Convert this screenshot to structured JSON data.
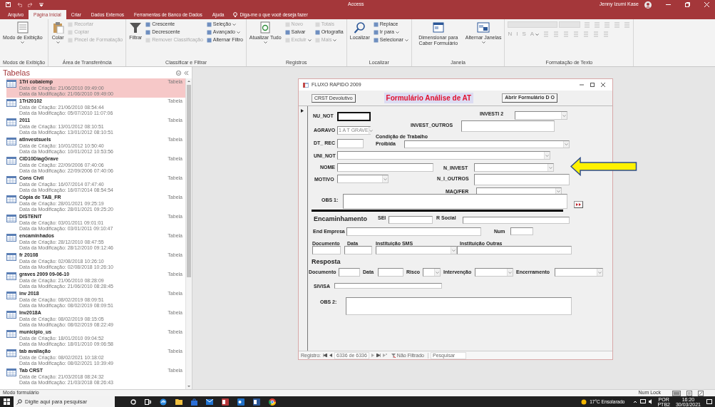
{
  "window": {
    "title": "Access",
    "user": "Jenny Izumi Kase"
  },
  "ribbon_tabs": [
    {
      "label": "Arquivo",
      "selected": false
    },
    {
      "label": "Página Inicial",
      "selected": true
    },
    {
      "label": "Criar",
      "selected": false
    },
    {
      "label": "Dados Externos",
      "selected": false
    },
    {
      "label": "Ferramentas de Banco de Dados",
      "selected": false
    },
    {
      "label": "Ajuda",
      "selected": false
    }
  ],
  "tell_me": {
    "placeholder": "Diga-me o que você deseja fazer"
  },
  "ribbon_groups": [
    {
      "label": "Modos de Exibição",
      "items": [
        {
          "kind": "large",
          "label": "Modo de Exibição",
          "dropdown": true,
          "disabled": false
        }
      ]
    },
    {
      "label": "Área de Transferência",
      "items": [
        {
          "kind": "large",
          "label": "Colar",
          "dropdown": true,
          "disabled": false
        },
        {
          "kind": "small",
          "label": "Recortar",
          "dropdown": false,
          "disabled": true
        },
        {
          "kind": "small",
          "label": "Copiar",
          "dropdown": false,
          "disabled": true
        },
        {
          "kind": "small",
          "label": "Pincel de Formatação",
          "dropdown": false,
          "disabled": true
        }
      ]
    },
    {
      "label": "Classificar e Filtrar",
      "items": [
        {
          "kind": "large",
          "label": "Filtrar",
          "dropdown": false,
          "disabled": false
        },
        {
          "kind": "small",
          "label": "Crescente",
          "dropdown": false,
          "disabled": false
        },
        {
          "kind": "small",
          "label": "Decrescente",
          "dropdown": false,
          "disabled": false
        },
        {
          "kind": "small",
          "label": "Remover Classificação",
          "dropdown": false,
          "disabled": true
        },
        {
          "kind": "small",
          "label": "Seleção",
          "dropdown": true,
          "disabled": false
        },
        {
          "kind": "small",
          "label": "Avançado",
          "dropdown": true,
          "disabled": false
        },
        {
          "kind": "small",
          "label": "Alternar Filtro",
          "dropdown": false,
          "disabled": false
        }
      ]
    },
    {
      "label": "Registros",
      "items": [
        {
          "kind": "large",
          "label": "Atualizar Tudo",
          "dropdown": true,
          "disabled": false
        },
        {
          "kind": "small",
          "label": "Novo",
          "dropdown": false,
          "disabled": true
        },
        {
          "kind": "small",
          "label": "Salvar",
          "dropdown": false,
          "disabled": false
        },
        {
          "kind": "small",
          "label": "Excluir",
          "dropdown": true,
          "disabled": true
        },
        {
          "kind": "small",
          "label": "Totais",
          "dropdown": false,
          "disabled": true
        },
        {
          "kind": "small",
          "label": "Ortografia",
          "dropdown": false,
          "disabled": false
        },
        {
          "kind": "small",
          "label": "Mais",
          "dropdown": true,
          "disabled": true
        }
      ]
    },
    {
      "label": "Localizar",
      "items": [
        {
          "kind": "large",
          "label": "Localizar",
          "dropdown": false,
          "disabled": false
        },
        {
          "kind": "small",
          "label": "Replace",
          "dropdown": false,
          "disabled": false
        },
        {
          "kind": "small",
          "label": "Ir para",
          "dropdown": true,
          "disabled": false
        },
        {
          "kind": "small",
          "label": "Selecionar",
          "dropdown": true,
          "disabled": false
        }
      ]
    },
    {
      "label": "Janela",
      "items": [
        {
          "kind": "large",
          "label": "Dimensionar para Caber Formulário",
          "dropdown": false,
          "disabled": false
        },
        {
          "kind": "large",
          "label": "Alternar Janelas",
          "dropdown": true,
          "disabled": false
        }
      ]
    },
    {
      "label": "Formatação de Texto",
      "items": [
        {
          "kind": "letter",
          "label": "N",
          "dropdown": false,
          "disabled": true
        },
        {
          "kind": "letter",
          "label": "I",
          "dropdown": false,
          "disabled": true
        },
        {
          "kind": "letter",
          "label": "S",
          "dropdown": false,
          "disabled": true
        },
        {
          "kind": "letter",
          "label": "A",
          "dropdown": true,
          "disabled": true
        }
      ]
    }
  ],
  "navigation_pane": {
    "title": "Tabelas",
    "items": [
      {
        "name": "1Tri cobaiemp",
        "type": "Tabela",
        "created": "Data de Criação: 21/06/2010 09:49:00",
        "modified": "Data da Modificação: 21/06/2010 09:49:00",
        "selected": true
      },
      {
        "name": "1Tri20102",
        "type": "Tabela",
        "created": "Data de Criação: 21/06/2010 08:54:44",
        "modified": "Data da Modificação: 05/07/2010 11:07:06",
        "selected": false
      },
      {
        "name": "2011",
        "type": "Tabela",
        "created": "Data de Criação: 13/01/2012 08:10:51",
        "modified": "Data da Modificação: 13/01/2012 08:10:51",
        "selected": false
      },
      {
        "name": "atlnvestsuels",
        "type": "Tabela",
        "created": "Data de Criação: 10/01/2012 10:50:40",
        "modified": "Data da Modificação: 10/01/2012 10:53:56",
        "selected": false
      },
      {
        "name": "CID10DiagGrave",
        "type": "Tabela",
        "created": "Data de Criação: 22/09/2006 07:40:06",
        "modified": "Data da Modificação: 22/09/2006 07:40:06",
        "selected": false
      },
      {
        "name": "Cons Civil",
        "type": "Tabela",
        "created": "Data de Criação: 16/07/2014 07:47:40",
        "modified": "Data da Modificação: 16/07/2014 08:54:54",
        "selected": false
      },
      {
        "name": "Cópia de TAB_FR",
        "type": "Tabela",
        "created": "Data de Criação: 28/01/2021 09:25:19",
        "modified": "Data da Modificação: 28/01/2021 09:25:20",
        "selected": false
      },
      {
        "name": "DISTENIT",
        "type": "Tabela",
        "created": "Data de Criação: 03/01/2011 09:01:01",
        "modified": "Data da Modificação: 03/01/2011 09:10:47",
        "selected": false
      },
      {
        "name": "encaminhados",
        "type": "Tabela",
        "created": "Data de Criação: 28/12/2010 08:47:55",
        "modified": "Data da Modificação: 28/12/2010 09:12:46",
        "selected": false
      },
      {
        "name": "fr 20108",
        "type": "Tabela",
        "created": "Data de Criação: 02/08/2018 10:26:10",
        "modified": "Data da Modificação: 02/08/2018 10:26:10",
        "selected": false
      },
      {
        "name": "graves 2009 09-06-10",
        "type": "Tabela",
        "created": "Data de Criação: 21/06/2010 08:28:09",
        "modified": "Data da Modificação: 21/06/2010 08:28:45",
        "selected": false
      },
      {
        "name": "inv 2018",
        "type": "Tabela",
        "created": "Data de Criação: 08/02/2019 08:09:51",
        "modified": "Data da Modificação: 08/02/2019 08:09:51",
        "selected": false
      },
      {
        "name": "Inv2018A",
        "type": "Tabela",
        "created": "Data de Criação: 08/02/2019 08:15:05",
        "modified": "Data da Modificação: 08/02/2019 08:22:49",
        "selected": false
      },
      {
        "name": "municipio_us",
        "type": "Tabela",
        "created": "Data de Criação: 18/01/2010 09:04:52",
        "modified": "Data da Modificação: 18/01/2010 09:06:58",
        "selected": false
      },
      {
        "name": "tab avaliação",
        "type": "Tabela",
        "created": "Data de Criação: 08/02/2021 10:18:02",
        "modified": "Data da Modificação: 08/02/2021 10:39:49",
        "selected": false
      },
      {
        "name": "Tab CRST",
        "type": "Tabela",
        "created": "Data de Criação: 21/03/2018 08:24:32",
        "modified": "Data da Modificação: 21/03/2018 08:26:43",
        "selected": false
      }
    ]
  },
  "form": {
    "title": "FLUXO RAPIDO 2009",
    "header_title": "Formulário Análise de AT",
    "header_buttons": [
      "CRST Devolutivo",
      "Abrir Formulário D O"
    ],
    "fields": [
      {
        "kind": "text",
        "label": "NU_NOT",
        "focused": true
      },
      {
        "kind": "combo",
        "label": "INVESTI 2",
        "focused": false
      },
      {
        "kind": "text",
        "label": "INVEST_OUTROS",
        "focused": false
      },
      {
        "kind": "combo",
        "label": "AGRAVO",
        "value": "1 A T GRAVE",
        "focused": false
      },
      {
        "kind": "caption",
        "label": "Condição de Trabalho"
      },
      {
        "kind": "combo",
        "label": "Proibida",
        "focused": false
      },
      {
        "kind": "text",
        "label": "DT_ REC",
        "focused": false
      },
      {
        "kind": "combo",
        "label": "UNI_NOT",
        "focused": false
      },
      {
        "kind": "text",
        "label": "NOME",
        "focused": false
      },
      {
        "kind": "combo",
        "label": "N_INVEST",
        "focused": false
      },
      {
        "kind": "combo",
        "label": "MOTIVO",
        "focused": false
      },
      {
        "kind": "text",
        "label": "N_I_OUTROS",
        "focused": false
      },
      {
        "kind": "combo",
        "label": "MAQ/FER",
        "focused": false
      },
      {
        "kind": "text",
        "label": "OBS 1:",
        "focused": false
      },
      {
        "kind": "heading",
        "label": "Encaminhamento"
      },
      {
        "kind": "text",
        "label": "SEI",
        "focused": false
      },
      {
        "kind": "text",
        "label": "R Social",
        "focused": false
      },
      {
        "kind": "text",
        "label": "End Empresa",
        "focused": false
      },
      {
        "kind": "text",
        "label": "Num",
        "focused": false
      },
      {
        "kind": "text",
        "label": "Documento",
        "focused": false
      },
      {
        "kind": "text",
        "label": "Data",
        "focused": false
      },
      {
        "kind": "combo",
        "label": "Instituição SMS",
        "focused": false
      },
      {
        "kind": "text",
        "label": "Instituição Outras",
        "focused": false
      },
      {
        "kind": "heading",
        "label": "Resposta"
      },
      {
        "kind": "text",
        "label": "Documento",
        "focused": false
      },
      {
        "kind": "text",
        "label": "Data",
        "focused": false
      },
      {
        "kind": "combo",
        "label": "Risco",
        "focused": false
      },
      {
        "kind": "combo",
        "label": "Intervenção",
        "focused": false
      },
      {
        "kind": "combo",
        "label": "Encerramento",
        "focused": false
      },
      {
        "kind": "text",
        "label": "SIVISA",
        "focused": false
      },
      {
        "kind": "text",
        "label": "OBS 2:",
        "focused": false
      }
    ],
    "record_nav": {
      "label": "Registro:",
      "position": "6336 de 6336",
      "filter": "Não Filtrado",
      "search": "Pesquisar"
    }
  },
  "status_bar": {
    "mode": "Modo formulário",
    "indicator": "Num Lock"
  },
  "taskbar": {
    "search_placeholder": "Digite aqui para pesquisar",
    "weather": "17°C Ensolarado",
    "language": "POR",
    "layout": "PTB2",
    "time": "16:20",
    "date": "30/03/2021"
  }
}
